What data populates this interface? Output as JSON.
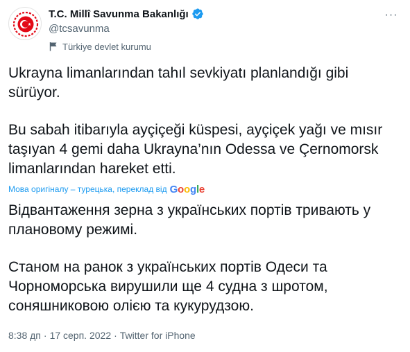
{
  "account": {
    "display_name": "T.C. Millî Savunma Bakanlığı",
    "handle": "@tcsavunma",
    "label": "Türkiye devlet kurumu",
    "verified_icon": "verified-badge-icon",
    "avatar_icon": "ministry-emblem-icon"
  },
  "more_icon_text": "···",
  "tweet": {
    "paragraphs": [
      "Ukrayna limanlarından tahıl sevkiyatı planlandığı gibi sürüyor.",
      "Bu sabah itibarıyla ayçiçeği küspesi, ayçiçek yağı ve mısır taşıyan 4 gemi daha Ukrayna’nın Odessa ve Çernomorsk limanlarından hareket etti."
    ]
  },
  "translation": {
    "note": "Мова оригіналу – турецька, переклад від",
    "provider_letters": [
      "G",
      "o",
      "o",
      "g",
      "l",
      "e"
    ],
    "paragraphs": [
      "Відвантаження зерна з українських портів тривають у плановому режимі.",
      "Станом на ранок з українських портів Одеси та Чорноморська вирушили ще 4 судна з шротом, соняшниковою олією та кукурудзою."
    ]
  },
  "meta": {
    "time": "8:38 дп",
    "separator": "·",
    "date": "17 серп. 2022",
    "source": "Twitter for iPhone"
  },
  "colors": {
    "accent": "#1d9bf0",
    "muted": "#536471",
    "text": "#0f1419",
    "emblem_red": "#e30a17"
  }
}
